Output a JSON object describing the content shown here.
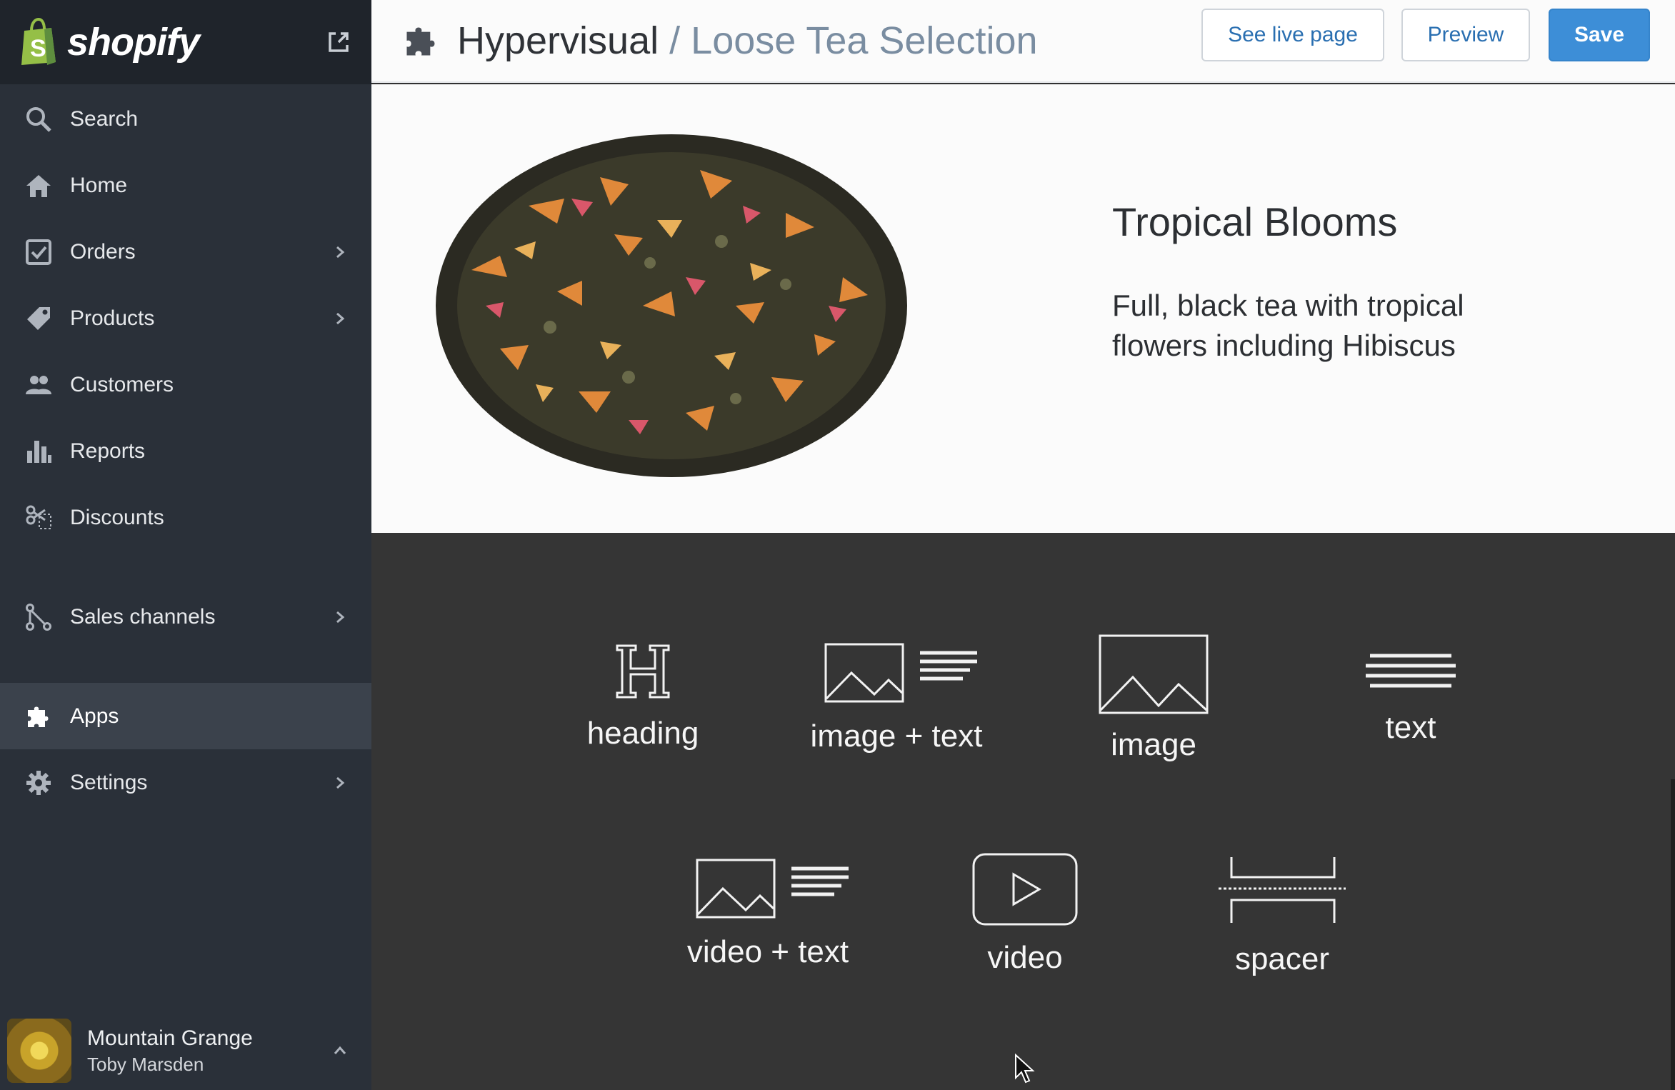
{
  "sidebar": {
    "brand": "shopify",
    "items": [
      {
        "label": "Search",
        "icon": "search-icon"
      },
      {
        "label": "Home",
        "icon": "home-icon"
      },
      {
        "label": "Orders",
        "icon": "orders-icon",
        "has_chevron": true
      },
      {
        "label": "Products",
        "icon": "tag-icon",
        "has_chevron": true
      },
      {
        "label": "Customers",
        "icon": "customers-icon"
      },
      {
        "label": "Reports",
        "icon": "bar-chart-icon"
      },
      {
        "label": "Discounts",
        "icon": "discount-icon"
      },
      {
        "label": "Sales channels",
        "icon": "channels-icon",
        "has_chevron": true
      },
      {
        "label": "Apps",
        "icon": "puzzle-icon",
        "active": true
      },
      {
        "label": "Settings",
        "icon": "gear-icon",
        "has_chevron": true
      }
    ],
    "store": {
      "name": "Mountain Grange",
      "user": "Toby Marsden"
    }
  },
  "topbar": {
    "app_name": "Hypervisual",
    "separator": "/",
    "page_name": "Loose Tea Selection",
    "buttons": {
      "live": "See live page",
      "preview": "Preview",
      "save": "Save"
    }
  },
  "product": {
    "title": "Tropical Blooms",
    "description": "Full, black tea with tropical flowers including Hibiscus"
  },
  "blocks": [
    {
      "label": "heading",
      "icon": "heading-icon"
    },
    {
      "label": "image + text",
      "icon": "image-text-icon"
    },
    {
      "label": "image",
      "icon": "image-icon"
    },
    {
      "label": "text",
      "icon": "text-lines-icon"
    },
    {
      "label": "video + text",
      "icon": "video-text-icon"
    },
    {
      "label": "video",
      "icon": "play-icon"
    },
    {
      "label": "spacer",
      "icon": "spacer-icon"
    }
  ],
  "colors": {
    "sidebar": "#2a3039",
    "accent": "#3d8ed7",
    "picker_bg": "#353535",
    "link": "#2a6fb1"
  }
}
